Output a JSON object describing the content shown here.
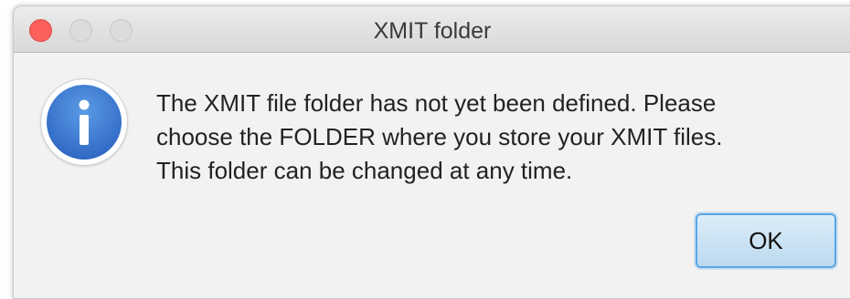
{
  "window": {
    "title": "XMIT folder"
  },
  "dialog": {
    "icon": "info-icon",
    "message_lines": [
      "The XMIT file folder has not yet been defined. Please",
      "choose the FOLDER where you store your XMIT files.",
      "This folder can be changed at any time."
    ],
    "ok_label": "OK"
  },
  "colors": {
    "close_button": "#fc605c",
    "inactive_button": "#dcdcdc",
    "icon_blue": "#3a78d4",
    "ok_border": "#5aa6e5",
    "dialog_background": "#f2f2f2"
  }
}
